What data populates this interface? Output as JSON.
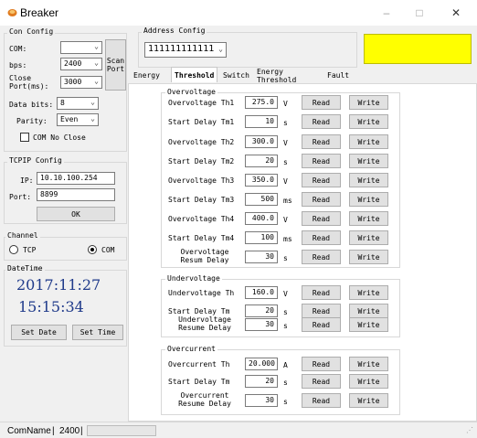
{
  "window": {
    "title": "Breaker",
    "min": "–",
    "max": "□",
    "close": "✕"
  },
  "com_config": {
    "title": "Con Config",
    "com_label": "COM:",
    "com_value": "",
    "bps_label": "bps:",
    "bps_value": "2400",
    "close_port_label": "Close\nPort(ms):",
    "close_port_value": "3000",
    "databits_label": "Data bits:",
    "databits_value": "8",
    "parity_label": "Parity:",
    "parity_value": "Even",
    "no_close_label": "COM No Close",
    "scan_port": "Scan\nPort"
  },
  "tcpip": {
    "title": "TCPIP Config",
    "ip_label": "IP:",
    "ip_value": "10.10.100.254",
    "port_label": "Port:",
    "port_value": "8899",
    "ok": "OK"
  },
  "channel": {
    "title": "Channel",
    "tcp": "TCP",
    "com": "COM",
    "selected": "COM"
  },
  "datetime": {
    "title": "DateTime",
    "date": "2017:11:27",
    "time": "15:15:34",
    "set_date": "Set Date",
    "set_time": "Set Time"
  },
  "address": {
    "title": "Address Config",
    "value": "111111111111",
    "status_color": "#ffff00"
  },
  "tabs": [
    "Energy",
    "Threshold",
    "Switch",
    "Energy Threshold",
    "Fault"
  ],
  "active_tab": "Threshold",
  "buttons": {
    "read": "Read",
    "write": "Write"
  },
  "overvoltage": {
    "title": "Overvoltage",
    "rows": [
      {
        "label": "Overvoltage Th1",
        "value": "275.0",
        "unit": "V"
      },
      {
        "label": "Start Delay Tm1",
        "value": "10",
        "unit": "s"
      },
      {
        "label": "Overvoltage Th2",
        "value": "300.0",
        "unit": "V"
      },
      {
        "label": "Start Delay Tm2",
        "value": "20",
        "unit": "s"
      },
      {
        "label": "Overvoltage Th3",
        "value": "350.0",
        "unit": "V"
      },
      {
        "label": "Start Delay Tm3",
        "value": "500",
        "unit": "ms"
      },
      {
        "label": "Overvoltage Th4",
        "value": "400.0",
        "unit": "V"
      },
      {
        "label": "Start Delay Tm4",
        "value": "100",
        "unit": "ms"
      },
      {
        "label": "Overvoltage\nResum Delay",
        "value": "30",
        "unit": "s"
      }
    ]
  },
  "undervoltage": {
    "title": "Undervoltage",
    "rows": [
      {
        "label": "Undervoltage Th",
        "value": "160.0",
        "unit": "V"
      },
      {
        "label": "Start Delay Tm",
        "value": "20",
        "unit": "s"
      },
      {
        "label": "Undervoltage\nResume Delay",
        "value": "30",
        "unit": "s"
      }
    ]
  },
  "overcurrent": {
    "title": "Overcurrent",
    "rows": [
      {
        "label": "Overcurrent Th",
        "value": "20.000",
        "unit": "A"
      },
      {
        "label": "Start Delay Tm",
        "value": "20",
        "unit": "s"
      },
      {
        "label": "Overcurrent\nResume Delay",
        "value": "30",
        "unit": "s"
      }
    ]
  },
  "status": {
    "com_name": "ComName",
    "sep1": "|",
    "bps": "2400",
    "sep2": "|"
  }
}
